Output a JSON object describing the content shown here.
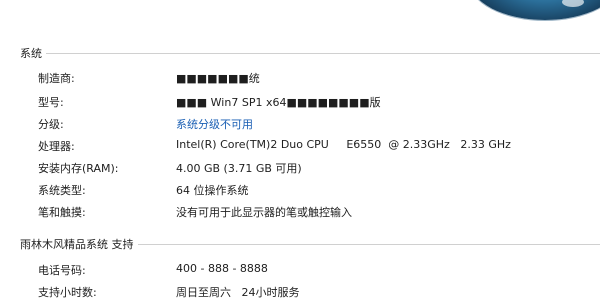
{
  "section_system": {
    "title": "系统",
    "rows": [
      {
        "label": "制造商:",
        "value": "■■■■■■■统"
      },
      {
        "label": "型号:",
        "value": "■■■ Win7 SP1 x64■■■■■■■■版"
      },
      {
        "label": "分级:",
        "value": "系统分级不可用"
      },
      {
        "label": "处理器:",
        "value": "Intel(R) Core(TM)2 Duo CPU     E6550  @ 2.33GHz   2.33 GHz"
      },
      {
        "label": "安装内存(RAM):",
        "value": "4.00 GB (3.71 GB 可用)"
      },
      {
        "label": "系统类型:",
        "value": "64 位操作系统"
      },
      {
        "label": "笔和触摸:",
        "value": "没有可用于此显示器的笔或触控输入"
      }
    ]
  },
  "section_support": {
    "title": "雨林木风精品系统 支持",
    "rows": [
      {
        "label": "电话号码:",
        "value": "400 - 888 - 8888"
      },
      {
        "label": "支持小时数:",
        "value": "周日至周六   24小时服务"
      }
    ]
  },
  "colors": {
    "link": "#1a5fb4",
    "rule": "#d0d0d0",
    "text": "#1e1e1e"
  }
}
